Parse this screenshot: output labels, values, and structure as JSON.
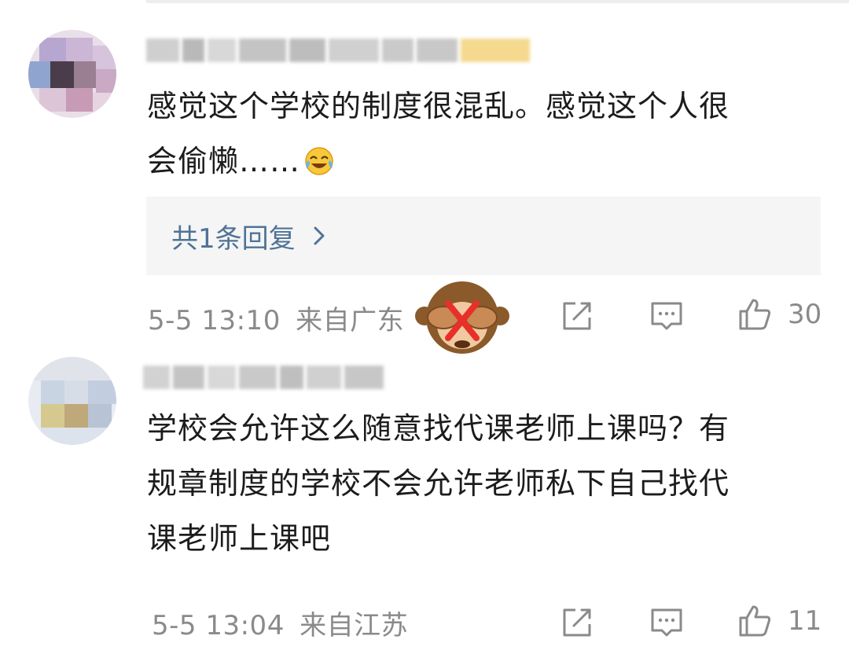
{
  "comments": [
    {
      "text_line1": "感觉这个学校的制度很混乱。感觉这个人很",
      "text_line2": "会偷懒……",
      "reply_label": "共1条回复",
      "timestamp": "5-5 13:10",
      "location": "来自广东",
      "like_count": "30"
    },
    {
      "text_line1": "学校会允许这么随意找代课老师上课吗？有",
      "text_line2": "规章制度的学校不会允许老师私下自己找代",
      "text_line3": "课老师上课吧",
      "timestamp": "5-5 13:04",
      "location": "来自江苏",
      "like_count": "11"
    }
  ],
  "icons": {
    "share": "share-icon",
    "comment": "comment-icon",
    "like": "thumbs-up-icon",
    "chevron": "chevron-right-icon",
    "emoji": "laughing-crying-emoji-icon",
    "sticker": "see-no-evil-monkey-sticker-icon"
  },
  "colors": {
    "link": "#4f7396",
    "meta": "#8a8a8a",
    "text": "#1c1c1c",
    "reply_bg": "#f5f5f5"
  }
}
